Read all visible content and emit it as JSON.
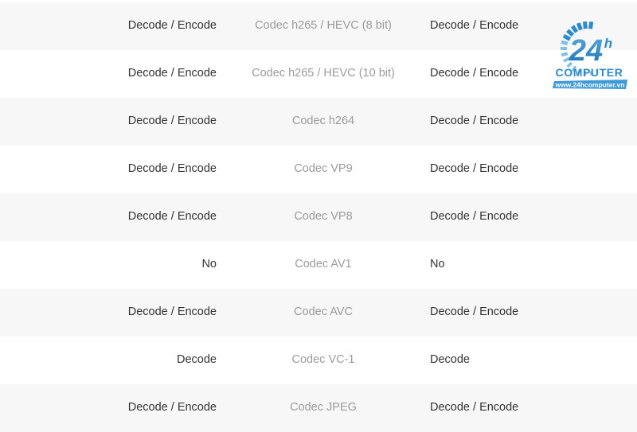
{
  "table": {
    "columns": [
      "left_support",
      "codec_name",
      "right_support"
    ],
    "rows": [
      {
        "left": "Decode / Encode",
        "codec": "Codec h265 / HEVC (8 bit)",
        "right": "Decode / Encode"
      },
      {
        "left": "Decode / Encode",
        "codec": "Codec h265 / HEVC (10 bit)",
        "right": "Decode / Encode"
      },
      {
        "left": "Decode / Encode",
        "codec": "Codec h264",
        "right": "Decode / Encode"
      },
      {
        "left": "Decode / Encode",
        "codec": "Codec VP9",
        "right": "Decode / Encode"
      },
      {
        "left": "Decode / Encode",
        "codec": "Codec VP8",
        "right": "Decode / Encode"
      },
      {
        "left": "No",
        "codec": "Codec AV1",
        "right": "No"
      },
      {
        "left": "Decode / Encode",
        "codec": "Codec AVC",
        "right": "Decode / Encode"
      },
      {
        "left": "Decode",
        "codec": "Codec VC-1",
        "right": "Decode"
      },
      {
        "left": "Decode / Encode",
        "codec": "Codec JPEG",
        "right": "Decode / Encode"
      }
    ]
  },
  "logo": {
    "number": "24",
    "hour_mark": "h",
    "wordmark": "COMPUTER",
    "url": "www.24hcomputer.vn",
    "brand_color": "#2a8bd4",
    "brand_color_dark": "#1b6fb5",
    "brand_color_light": "#7cc0e8"
  },
  "colors": {
    "row_shaded": "#f7f7f7",
    "row_plain": "#ffffff",
    "text_primary": "#333333",
    "text_muted": "#9b9b9b"
  }
}
